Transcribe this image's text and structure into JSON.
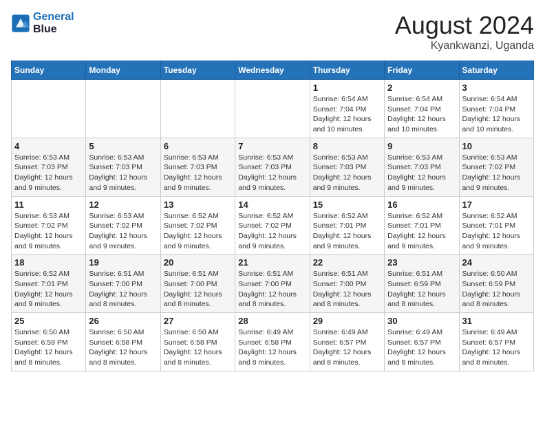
{
  "header": {
    "logo_line1": "General",
    "logo_line2": "Blue",
    "month_year": "August 2024",
    "location": "Kyankwanzi, Uganda"
  },
  "weekdays": [
    "Sunday",
    "Monday",
    "Tuesday",
    "Wednesday",
    "Thursday",
    "Friday",
    "Saturday"
  ],
  "weeks": [
    [
      {
        "day": "",
        "info": ""
      },
      {
        "day": "",
        "info": ""
      },
      {
        "day": "",
        "info": ""
      },
      {
        "day": "",
        "info": ""
      },
      {
        "day": "1",
        "info": "Sunrise: 6:54 AM\nSunset: 7:04 PM\nDaylight: 12 hours\nand 10 minutes."
      },
      {
        "day": "2",
        "info": "Sunrise: 6:54 AM\nSunset: 7:04 PM\nDaylight: 12 hours\nand 10 minutes."
      },
      {
        "day": "3",
        "info": "Sunrise: 6:54 AM\nSunset: 7:04 PM\nDaylight: 12 hours\nand 10 minutes."
      }
    ],
    [
      {
        "day": "4",
        "info": "Sunrise: 6:53 AM\nSunset: 7:03 PM\nDaylight: 12 hours\nand 9 minutes."
      },
      {
        "day": "5",
        "info": "Sunrise: 6:53 AM\nSunset: 7:03 PM\nDaylight: 12 hours\nand 9 minutes."
      },
      {
        "day": "6",
        "info": "Sunrise: 6:53 AM\nSunset: 7:03 PM\nDaylight: 12 hours\nand 9 minutes."
      },
      {
        "day": "7",
        "info": "Sunrise: 6:53 AM\nSunset: 7:03 PM\nDaylight: 12 hours\nand 9 minutes."
      },
      {
        "day": "8",
        "info": "Sunrise: 6:53 AM\nSunset: 7:03 PM\nDaylight: 12 hours\nand 9 minutes."
      },
      {
        "day": "9",
        "info": "Sunrise: 6:53 AM\nSunset: 7:03 PM\nDaylight: 12 hours\nand 9 minutes."
      },
      {
        "day": "10",
        "info": "Sunrise: 6:53 AM\nSunset: 7:02 PM\nDaylight: 12 hours\nand 9 minutes."
      }
    ],
    [
      {
        "day": "11",
        "info": "Sunrise: 6:53 AM\nSunset: 7:02 PM\nDaylight: 12 hours\nand 9 minutes."
      },
      {
        "day": "12",
        "info": "Sunrise: 6:53 AM\nSunset: 7:02 PM\nDaylight: 12 hours\nand 9 minutes."
      },
      {
        "day": "13",
        "info": "Sunrise: 6:52 AM\nSunset: 7:02 PM\nDaylight: 12 hours\nand 9 minutes."
      },
      {
        "day": "14",
        "info": "Sunrise: 6:52 AM\nSunset: 7:02 PM\nDaylight: 12 hours\nand 9 minutes."
      },
      {
        "day": "15",
        "info": "Sunrise: 6:52 AM\nSunset: 7:01 PM\nDaylight: 12 hours\nand 9 minutes."
      },
      {
        "day": "16",
        "info": "Sunrise: 6:52 AM\nSunset: 7:01 PM\nDaylight: 12 hours\nand 9 minutes."
      },
      {
        "day": "17",
        "info": "Sunrise: 6:52 AM\nSunset: 7:01 PM\nDaylight: 12 hours\nand 9 minutes."
      }
    ],
    [
      {
        "day": "18",
        "info": "Sunrise: 6:52 AM\nSunset: 7:01 PM\nDaylight: 12 hours\nand 9 minutes."
      },
      {
        "day": "19",
        "info": "Sunrise: 6:51 AM\nSunset: 7:00 PM\nDaylight: 12 hours\nand 8 minutes."
      },
      {
        "day": "20",
        "info": "Sunrise: 6:51 AM\nSunset: 7:00 PM\nDaylight: 12 hours\nand 8 minutes."
      },
      {
        "day": "21",
        "info": "Sunrise: 6:51 AM\nSunset: 7:00 PM\nDaylight: 12 hours\nand 8 minutes."
      },
      {
        "day": "22",
        "info": "Sunrise: 6:51 AM\nSunset: 7:00 PM\nDaylight: 12 hours\nand 8 minutes."
      },
      {
        "day": "23",
        "info": "Sunrise: 6:51 AM\nSunset: 6:59 PM\nDaylight: 12 hours\nand 8 minutes."
      },
      {
        "day": "24",
        "info": "Sunrise: 6:50 AM\nSunset: 6:59 PM\nDaylight: 12 hours\nand 8 minutes."
      }
    ],
    [
      {
        "day": "25",
        "info": "Sunrise: 6:50 AM\nSunset: 6:59 PM\nDaylight: 12 hours\nand 8 minutes."
      },
      {
        "day": "26",
        "info": "Sunrise: 6:50 AM\nSunset: 6:58 PM\nDaylight: 12 hours\nand 8 minutes."
      },
      {
        "day": "27",
        "info": "Sunrise: 6:50 AM\nSunset: 6:58 PM\nDaylight: 12 hours\nand 8 minutes."
      },
      {
        "day": "28",
        "info": "Sunrise: 6:49 AM\nSunset: 6:58 PM\nDaylight: 12 hours\nand 8 minutes."
      },
      {
        "day": "29",
        "info": "Sunrise: 6:49 AM\nSunset: 6:57 PM\nDaylight: 12 hours\nand 8 minutes."
      },
      {
        "day": "30",
        "info": "Sunrise: 6:49 AM\nSunset: 6:57 PM\nDaylight: 12 hours\nand 8 minutes."
      },
      {
        "day": "31",
        "info": "Sunrise: 6:49 AM\nSunset: 6:57 PM\nDaylight: 12 hours\nand 8 minutes."
      }
    ]
  ]
}
